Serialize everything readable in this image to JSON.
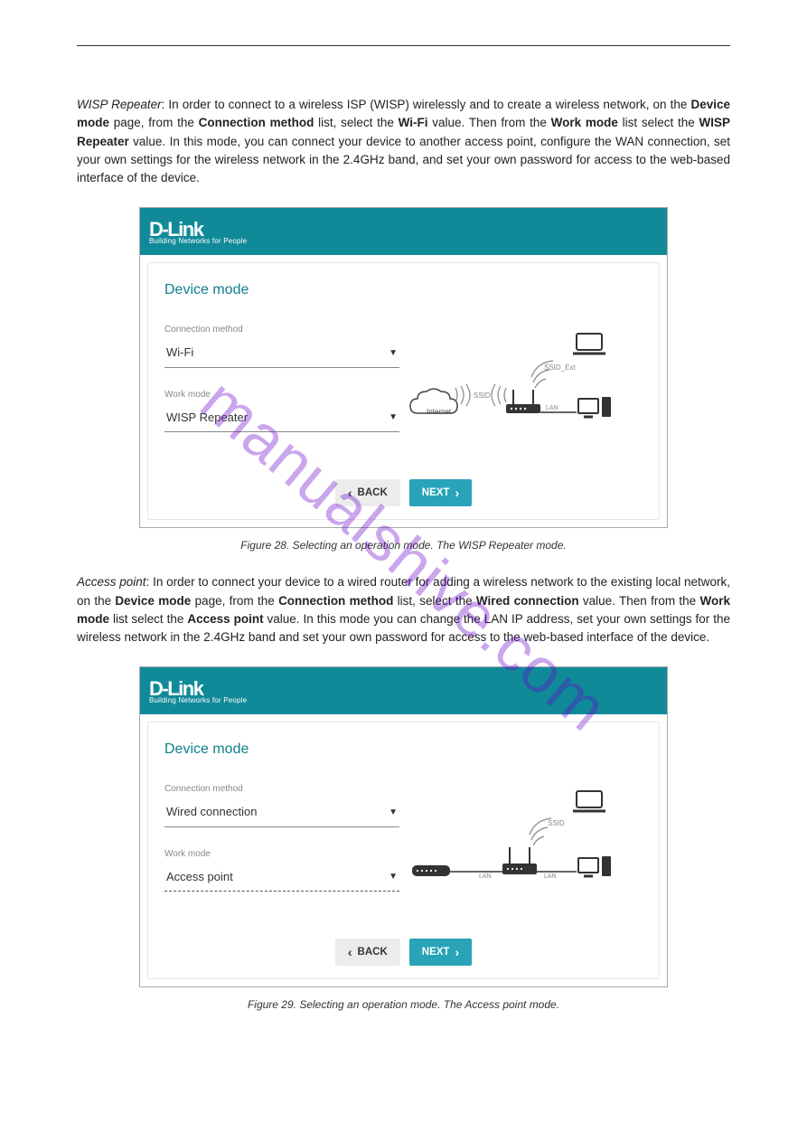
{
  "watermark": "manualshive.com",
  "intro1_a": "WISP Repeater",
  "intro1_b": ": In order to connect to a wireless ISP (WISP) wirelessly and to create a wireless network, on the ",
  "intro1_c": "Device mode",
  "intro1_d": " page, from the ",
  "intro1_e": "Connection method",
  "intro1_f": " list, select the ",
  "intro1_g": "Wi-Fi",
  "intro1_h": " value. Then from the ",
  "intro1_i": "Work mode",
  "intro1_j": " list select the ",
  "intro1_k": "WISP Repeater",
  "intro1_l": " value. In this mode, you can connect your device to another access point, configure the WAN connection, set your own settings for the wireless network in the 2.4GHz band, and set your own password for access to the web-based interface of the device.",
  "fig1": {
    "brand_top": "D-Link",
    "brand_sub": "Building Networks for People",
    "card_title": "Device mode",
    "conn_label": "Connection method",
    "conn_value": "Wi-Fi",
    "work_label": "Work mode",
    "work_value": "WISP Repeater",
    "back": "BACK",
    "next": "NEXT",
    "diag": {
      "internet": "Internet",
      "ssid": "SSID",
      "ssid_ext": "SSID_Ext",
      "lan": "LAN"
    }
  },
  "caption1": "Figure 28. Selecting an operation mode. The WISP Repeater mode.",
  "intro2_a": "Access point",
  "intro2_b": ": In order to connect your device to a wired router for adding a wireless network to the existing local network, on the ",
  "intro2_c": "Device mode",
  "intro2_d": " page, from the ",
  "intro2_e": "Connection method",
  "intro2_f": " list, select the ",
  "intro2_g": "Wired connection",
  "intro2_h": " value. Then from the ",
  "intro2_i": "Work mode",
  "intro2_j": " list select the ",
  "intro2_k": "Access point",
  "intro2_l": " value. In this mode you can change the LAN IP address, set your own settings for the wireless network in the 2.4GHz band and set your own password for access to the web-based interface of the device.",
  "fig2": {
    "brand_top": "D-Link",
    "brand_sub": "Building Networks for People",
    "card_title": "Device mode",
    "conn_label": "Connection method",
    "conn_value": "Wired connection",
    "work_label": "Work mode",
    "work_value": "Access point",
    "back": "BACK",
    "next": "NEXT",
    "diag": {
      "ssid": "SSID",
      "lan": "LAN"
    }
  },
  "caption2": "Figure 29. Selecting an operation mode. The Access point mode."
}
